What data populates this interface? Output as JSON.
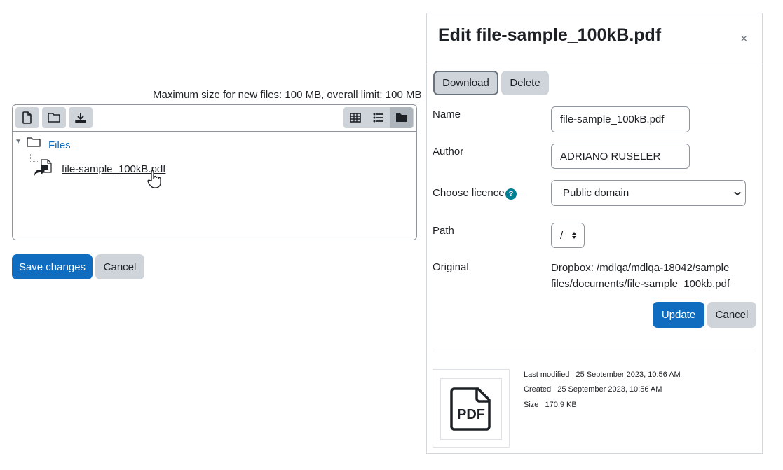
{
  "filemanager": {
    "max_size_text": "Maximum size for new files: 100 MB, overall limit: 100 MB",
    "toolbar": {
      "add_file_icon": "file-icon",
      "create_folder_icon": "folder-icon",
      "download_all_icon": "download-icon",
      "view_grid_icon": "grid-icon",
      "view_list_icon": "list-icon",
      "view_tree_icon": "folder-solid-icon"
    },
    "tree": {
      "root_label": "Files",
      "file_label": "file-sample_100kB.pdf"
    }
  },
  "form_buttons": {
    "save_label": "Save changes",
    "cancel_label": "Cancel"
  },
  "edit_panel": {
    "title": "Edit file-sample_100kB.pdf",
    "close_symbol": "×",
    "download_label": "Download",
    "delete_label": "Delete",
    "name_label": "Name",
    "name_value": "file-sample_100kB.pdf",
    "author_label": "Author",
    "author_value": "ADRIANO RUSELER",
    "licence_label": "Choose licence",
    "licence_help": "?",
    "licence_value": "Public domain",
    "path_label": "Path",
    "path_value": "/",
    "original_label": "Original",
    "original_value": "Dropbox: /mdlqa/mdlqa-18042/sample files/documents/file-sample_100kb.pdf",
    "update_label": "Update",
    "cancel_label": "Cancel",
    "thumbnail_text": "PDF",
    "meta": {
      "last_modified_label": "Last modified",
      "last_modified_value": "25 September 2023, 10:56 AM",
      "created_label": "Created",
      "created_value": "25 September 2023, 10:56 AM",
      "size_label": "Size",
      "size_value": "170.9 KB"
    }
  },
  "colors": {
    "primary": "#0f6cbf",
    "secondary": "#ced4da",
    "help": "#008196",
    "link": "#0f6cbf"
  }
}
